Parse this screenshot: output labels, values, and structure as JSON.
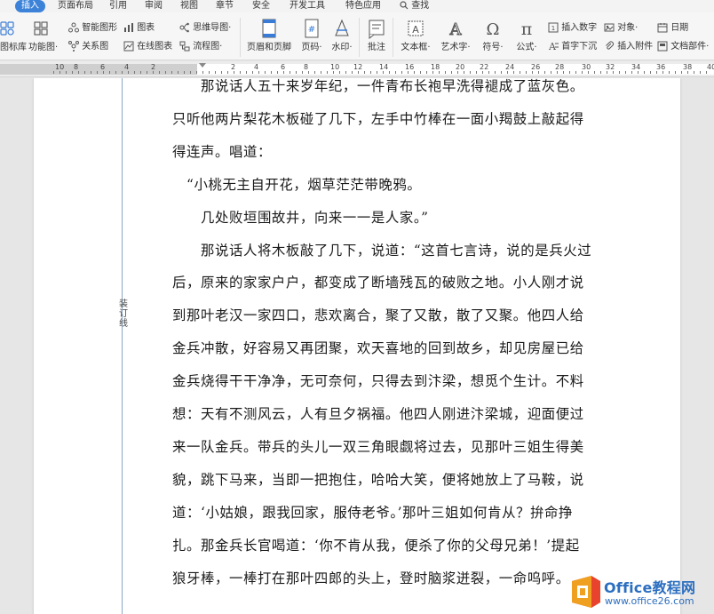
{
  "menu": {
    "tabs": [
      "插入",
      "页面布局",
      "引用",
      "审阅",
      "视图",
      "章节",
      "安全",
      "开发工具",
      "特色应用"
    ],
    "active_tab": "插入",
    "search_label": "查找"
  },
  "ribbon": {
    "icon_library": "图标库",
    "function_chart": "功能图·",
    "smart_shape": "智能图形",
    "chart": "图表",
    "mind_map": "思维导图·",
    "relation_chart": "关系图",
    "online_chart": "在线图表",
    "flow_chart": "流程图·",
    "header_footer": "页眉和页脚",
    "page_number": "页码·",
    "watermark": "水印·",
    "annotation": "批注",
    "textbox": "文本框·",
    "wordart": "艺术字·",
    "symbol": "符号·",
    "formula": "公式·",
    "insert_number": "插入数字",
    "object": "对象·",
    "date": "日期",
    "drop_cap": "首字下沉",
    "insert_attachment": "插入附件",
    "doc_parts": "文档部件·"
  },
  "ruler": {
    "numbers": [
      "10",
      "8",
      "6",
      "4",
      "2",
      "2",
      "4",
      "6",
      "8",
      "10",
      "12",
      "14",
      "16",
      "18",
      "20",
      "22",
      "24",
      "26",
      "28",
      "30",
      "32",
      "34",
      "36",
      "38",
      "40",
      "42"
    ]
  },
  "document": {
    "gutter_label": "装订线",
    "lines": [
      "　　那说话人五十来岁年纪，一件青布长袍早洗得褪成了蓝灰色。",
      "只听他两片梨花木板碰了几下，左手中竹棒在一面小羯鼓上敲起得",
      "得连声。唱道：",
      "　“小桃无主自开花，烟草茫茫带晚鸦。",
      "　　几处败垣围故井，向来一一是人家。”",
      "　　那说话人将木板敲了几下，说道：“这首七言诗，说的是兵火过",
      "后，原来的家家户户，都变成了断墙残瓦的破败之地。小人刚才说",
      "到那叶老汉一家四口，悲欢离合，聚了又散，散了又聚。他四人给",
      "金兵冲散，好容易又再团聚，欢天喜地的回到故乡，却见房屋已给",
      "金兵烧得干干净净，无可奈何，只得去到汴梁，想觅个生计。不料",
      "想：天有不测风云，人有旦夕祸福。他四人刚进汴梁城，迎面便过",
      "来一队金兵。带兵的头儿一双三角眼觑将过去，见那叶三姐生得美",
      "貌，跳下马来，当即一把抱住，哈哈大笑，便将她放上了马鞍，说",
      "道：‘小姑娘，跟我回家，服侍老爷。’那叶三姐如何肯从？拚命挣",
      "扎。那金兵长官喝道：‘你不肯从我，便杀了你的父母兄弟！’提起",
      "狼牙棒，一棒打在那叶四郎的头上，登时脑浆迸裂，一命呜呼。"
    ]
  },
  "watermark": {
    "brand": "Office教程网",
    "url": "www.office26.com",
    "colors": {
      "orange": "#f0a020",
      "red": "#e8432c",
      "blue": "#2c6fc0"
    }
  }
}
